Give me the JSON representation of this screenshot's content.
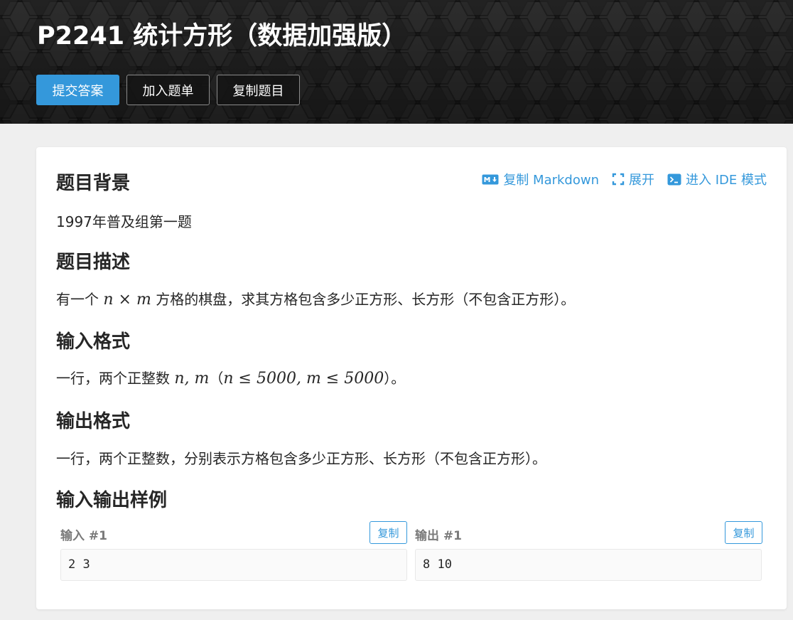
{
  "header": {
    "title": "P2241 统计方形（数据加强版）",
    "buttons": {
      "submit": "提交答案",
      "add_to_list": "加入题单",
      "copy_problem": "复制题目"
    }
  },
  "toolbar": {
    "copy_markdown": "复制 Markdown",
    "expand": "展开",
    "ide_mode": "进入 IDE 模式"
  },
  "sections": {
    "background": {
      "title": "题目背景",
      "text": "1997年普及组第一题"
    },
    "description": {
      "title": "题目描述",
      "text_before": "有一个",
      "math_n": "n",
      "math_times": "×",
      "math_m": "m",
      "text_after": "方格的棋盘，求其方格包含多少正方形、长方形（不包含正方形）。"
    },
    "input_format": {
      "title": "输入格式",
      "text_before": "一行，两个正整数",
      "math_vars": "n, m",
      "math_paren_open": "（",
      "math_cond": "n ≤ 5000, m ≤ 5000",
      "math_paren_close": "）。"
    },
    "output_format": {
      "title": "输出格式",
      "text": "一行，两个正整数，分别表示方格包含多少正方形、长方形（不包含正方形）。"
    },
    "samples": {
      "title": "输入输出样例",
      "input_label": "输入 #1",
      "output_label": "输出 #1",
      "copy_label": "复制",
      "input_value": "2 3",
      "output_value": "8 10"
    }
  },
  "colors": {
    "accent": "#3498db",
    "banner_bg": "#1e1e1e",
    "page_bg": "#efefef"
  }
}
